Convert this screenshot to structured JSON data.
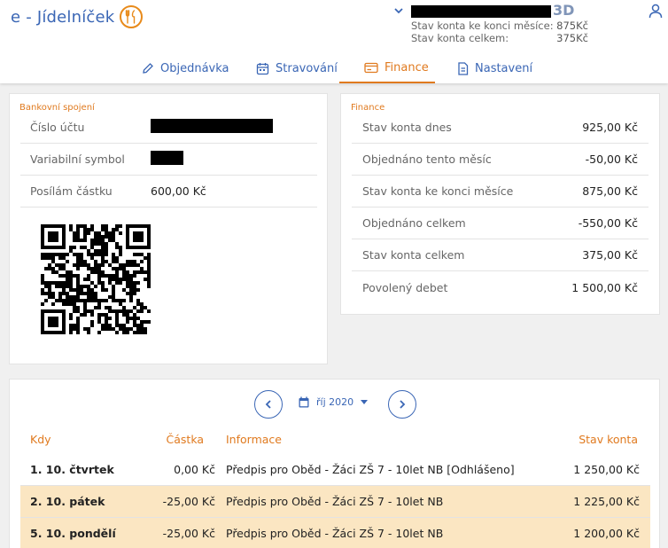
{
  "app": {
    "title": "e - Jídelníček"
  },
  "account": {
    "class": "3D",
    "rows": [
      {
        "label": "Stav konta ke konci měsíce:",
        "value": "875Kč"
      },
      {
        "label": "Stav konta celkem:",
        "value": "375Kč"
      }
    ]
  },
  "tabs": [
    {
      "label": "Objednávka",
      "icon": "pencil-icon",
      "active": false
    },
    {
      "label": "Stravování",
      "icon": "calendar-icon",
      "active": false
    },
    {
      "label": "Finance",
      "icon": "card-icon",
      "active": true
    },
    {
      "label": "Nastavení",
      "icon": "document-icon",
      "active": false
    }
  ],
  "bank": {
    "title": "Bankovní spojení",
    "account_label": "Číslo účtu",
    "vs_label": "Variabilní symbol",
    "amount_label": "Posílám částku",
    "amount_value": "600,00 Kč"
  },
  "finance": {
    "title": "Finance",
    "rows": [
      {
        "label": "Stav konta dnes",
        "value": "925,00 Kč"
      },
      {
        "label": "Objednáno tento měsíc",
        "value": "-50,00 Kč"
      },
      {
        "label": "Stav konta ke konci měsíce",
        "value": "875,00 Kč"
      },
      {
        "label": "Objednáno celkem",
        "value": "-550,00 Kč"
      },
      {
        "label": "Stav konta celkem",
        "value": "375,00 Kč"
      },
      {
        "label": "Povolený debet",
        "value": "1 500,00 Kč"
      }
    ]
  },
  "history": {
    "month": "říj 2020",
    "columns": {
      "date": "Kdy",
      "amount": "Částka",
      "info": "Informace",
      "balance": "Stav konta"
    },
    "rows": [
      {
        "date": "1. 10. čtvrtek",
        "amount": "0,00 Kč",
        "info": "Předpis pro Oběd - Žáci ZŠ 7 - 10let NB [Odhlášeno]",
        "balance": "1 250,00 Kč",
        "highlight": false
      },
      {
        "date": "2. 10. pátek",
        "amount": "-25,00 Kč",
        "info": "Předpis pro Oběd - Žáci ZŠ 7 - 10let NB",
        "balance": "1 225,00 Kč",
        "highlight": true
      },
      {
        "date": "5. 10. pondělí",
        "amount": "-25,00 Kč",
        "info": "Předpis pro Oběd - Žáci ZŠ 7 - 10let NB",
        "balance": "1 200,00 Kč",
        "highlight": true
      }
    ]
  },
  "colors": {
    "primary": "#3a66b5",
    "accent": "#e07a1f",
    "highlight": "#fbe6c2"
  }
}
